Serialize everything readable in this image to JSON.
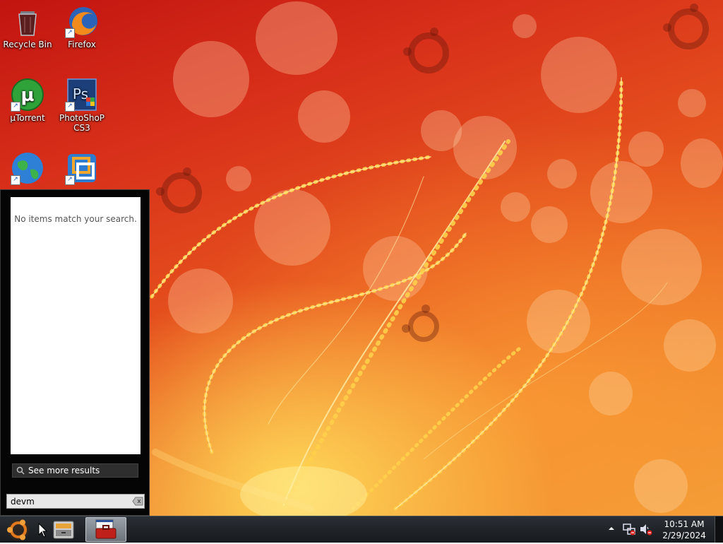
{
  "desktop": {
    "icons": [
      {
        "label": "Recycle Bin",
        "icon": "recycle-bin-icon"
      },
      {
        "label": "Firefox",
        "icon": "firefox-icon"
      },
      {
        "label": "µTorrent",
        "icon": "utorrent-icon"
      },
      {
        "label": "PhotoShoP CS3",
        "icon": "photoshop-icon"
      },
      {
        "label": "",
        "icon": "internet-globe-icon"
      },
      {
        "label": "",
        "icon": "vmware-icon"
      }
    ]
  },
  "start_menu": {
    "no_results_text": "No items match your search.",
    "see_more_label": "See more results",
    "search_value": "devm"
  },
  "taskbar": {
    "clock_time": "10:51 AM",
    "clock_date": "2/29/2024",
    "pinned": [
      "file-manager-icon",
      "toolbox-icon"
    ]
  },
  "colors": {
    "wallpaper_red": "#c21410",
    "wallpaper_orange": "#f0832a",
    "glow_yellow": "#ffd95a",
    "taskbar": "#1f2328"
  }
}
